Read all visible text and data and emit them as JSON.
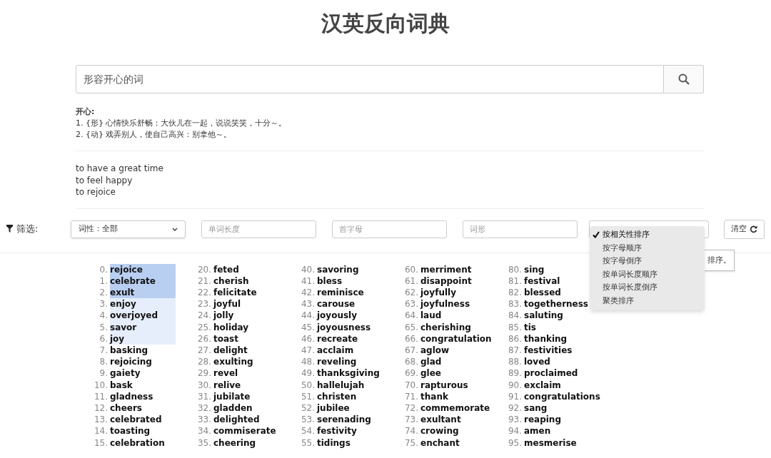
{
  "title": "汉英反向词典",
  "search": {
    "value": "形容开心的词"
  },
  "definition": {
    "headword": "开心:",
    "senses": [
      "1. {形} 心情快乐舒畅：大伙儿在一起，说说笑笑，十分～。",
      "2. {动} 戏弄别人，使自己高兴：别拿他～。"
    ]
  },
  "translations": [
    "to have a great time",
    "to feel happy",
    "to rejoice"
  ],
  "filter": {
    "label": "筛选:",
    "pos_select": "词性：全部",
    "fields": [
      {
        "placeholder": "单词长度"
      },
      {
        "placeholder": "首字母"
      },
      {
        "placeholder": "词形"
      }
    ],
    "clear_button": "清空"
  },
  "sort_menu": [
    {
      "label": "按相关性排序",
      "selected": true
    },
    {
      "label": "按字母顺序",
      "selected": false
    },
    {
      "label": "按字母倒序",
      "selected": false
    },
    {
      "label": "按单词长度顺序",
      "selected": false
    },
    {
      "label": "按单词长度倒序",
      "selected": false
    },
    {
      "label": "聚类排序",
      "selected": false
    }
  ],
  "tooltip": "排序。",
  "results": [
    [
      {
        "num": "0.",
        "word": "rejoice",
        "color": "#b9cff2"
      },
      {
        "num": "1.",
        "word": "celebrate",
        "color": "#b9cff2"
      },
      {
        "num": "2.",
        "word": "exult",
        "color": "#b9cff2"
      },
      {
        "num": "3.",
        "word": "enjoy",
        "color": "#e6eefb"
      },
      {
        "num": "4.",
        "word": "overjoyed",
        "color": "#e6eefb"
      },
      {
        "num": "5.",
        "word": "savor",
        "color": "#e6eefb"
      },
      {
        "num": "6.",
        "word": "joy",
        "color": "#e6eefb"
      },
      {
        "num": "7.",
        "word": "basking"
      },
      {
        "num": "8.",
        "word": "rejoicing"
      },
      {
        "num": "9.",
        "word": "gaiety"
      },
      {
        "num": "10.",
        "word": "bask"
      },
      {
        "num": "11.",
        "word": "gladness"
      },
      {
        "num": "12.",
        "word": "cheers"
      },
      {
        "num": "13.",
        "word": "celebrated"
      },
      {
        "num": "14.",
        "word": "toasting"
      },
      {
        "num": "15.",
        "word": "celebration"
      }
    ],
    [
      {
        "num": "20.",
        "word": "feted"
      },
      {
        "num": "21.",
        "word": "cherish"
      },
      {
        "num": "22.",
        "word": "felicitate"
      },
      {
        "num": "23.",
        "word": "joyful"
      },
      {
        "num": "24.",
        "word": "jolly"
      },
      {
        "num": "25.",
        "word": "holiday"
      },
      {
        "num": "26.",
        "word": "toast"
      },
      {
        "num": "27.",
        "word": "delight"
      },
      {
        "num": "28.",
        "word": "exulting"
      },
      {
        "num": "29.",
        "word": "revel"
      },
      {
        "num": "30.",
        "word": "relive"
      },
      {
        "num": "31.",
        "word": "jubilate"
      },
      {
        "num": "32.",
        "word": "gladden"
      },
      {
        "num": "33.",
        "word": "delighted"
      },
      {
        "num": "34.",
        "word": "commiserate"
      },
      {
        "num": "35.",
        "word": "cheering"
      }
    ],
    [
      {
        "num": "40.",
        "word": "savoring"
      },
      {
        "num": "41.",
        "word": "bless"
      },
      {
        "num": "42.",
        "word": "reminisce"
      },
      {
        "num": "43.",
        "word": "carouse"
      },
      {
        "num": "44.",
        "word": "joyously"
      },
      {
        "num": "45.",
        "word": "joyousness"
      },
      {
        "num": "46.",
        "word": "recreate"
      },
      {
        "num": "47.",
        "word": "acclaim"
      },
      {
        "num": "48.",
        "word": "reveling"
      },
      {
        "num": "49.",
        "word": "thanksgiving"
      },
      {
        "num": "50.",
        "word": "hallelujah"
      },
      {
        "num": "51.",
        "word": "christen"
      },
      {
        "num": "52.",
        "word": "jubilee"
      },
      {
        "num": "53.",
        "word": "serenading"
      },
      {
        "num": "54.",
        "word": "festivity"
      },
      {
        "num": "55.",
        "word": "tidings"
      }
    ],
    [
      {
        "num": "60.",
        "word": "merriment"
      },
      {
        "num": "61.",
        "word": "disappoint"
      },
      {
        "num": "62.",
        "word": "joyfully"
      },
      {
        "num": "63.",
        "word": "joyfulness"
      },
      {
        "num": "64.",
        "word": "laud"
      },
      {
        "num": "65.",
        "word": "cherishing"
      },
      {
        "num": "66.",
        "word": "congratulation"
      },
      {
        "num": "67.",
        "word": "aglow"
      },
      {
        "num": "68.",
        "word": "glad"
      },
      {
        "num": "69.",
        "word": "glee"
      },
      {
        "num": "70.",
        "word": "rapturous"
      },
      {
        "num": "71.",
        "word": "thank"
      },
      {
        "num": "72.",
        "word": "commemorate"
      },
      {
        "num": "73.",
        "word": "exultant"
      },
      {
        "num": "74.",
        "word": "crowing"
      },
      {
        "num": "75.",
        "word": "enchant"
      }
    ],
    [
      {
        "num": "80.",
        "word": "sing"
      },
      {
        "num": "81.",
        "word": "festival"
      },
      {
        "num": "82.",
        "word": "blessed"
      },
      {
        "num": "83.",
        "word": "togetherness"
      },
      {
        "num": "84.",
        "word": "saluting"
      },
      {
        "num": "85.",
        "word": "tis"
      },
      {
        "num": "86.",
        "word": "thanking"
      },
      {
        "num": "87.",
        "word": "festivities"
      },
      {
        "num": "88.",
        "word": "loved"
      },
      {
        "num": "89.",
        "word": "proclaimed"
      },
      {
        "num": "90.",
        "word": "exclaim"
      },
      {
        "num": "91.",
        "word": "congratulations"
      },
      {
        "num": "92.",
        "word": "sang"
      },
      {
        "num": "93.",
        "word": "reaping"
      },
      {
        "num": "94.",
        "word": "amen"
      },
      {
        "num": "95.",
        "word": "mesmerise"
      }
    ]
  ]
}
